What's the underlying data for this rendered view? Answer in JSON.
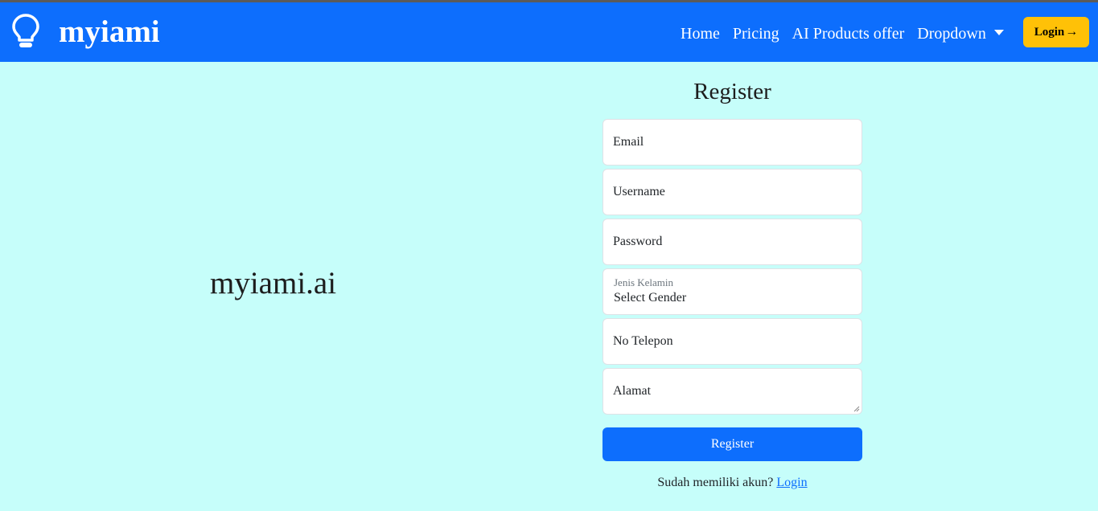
{
  "navbar": {
    "brand": "myiami",
    "brand_icon": "lightbulb-icon",
    "links": [
      "Home",
      "Pricing",
      "AI Products offer",
      "Dropdown"
    ],
    "login_label": "Login",
    "login_icon": "arrow-right-icon"
  },
  "hero": {
    "title": "myiami.ai"
  },
  "form": {
    "title": "Register",
    "email_placeholder": "Email",
    "username_placeholder": "Username",
    "password_placeholder": "Password",
    "gender_label": "Jenis Kelamin",
    "gender_value": "Select Gender",
    "phone_placeholder": "No Telepon",
    "address_placeholder": "Alamat",
    "submit_label": "Register",
    "login_prompt": "Sudah memiliki akun?",
    "login_link": "Login"
  },
  "colors": {
    "navbar": "#0d6efd",
    "background": "#c6fefa",
    "login_button": "#ffc107",
    "primary": "#0d6efd"
  }
}
